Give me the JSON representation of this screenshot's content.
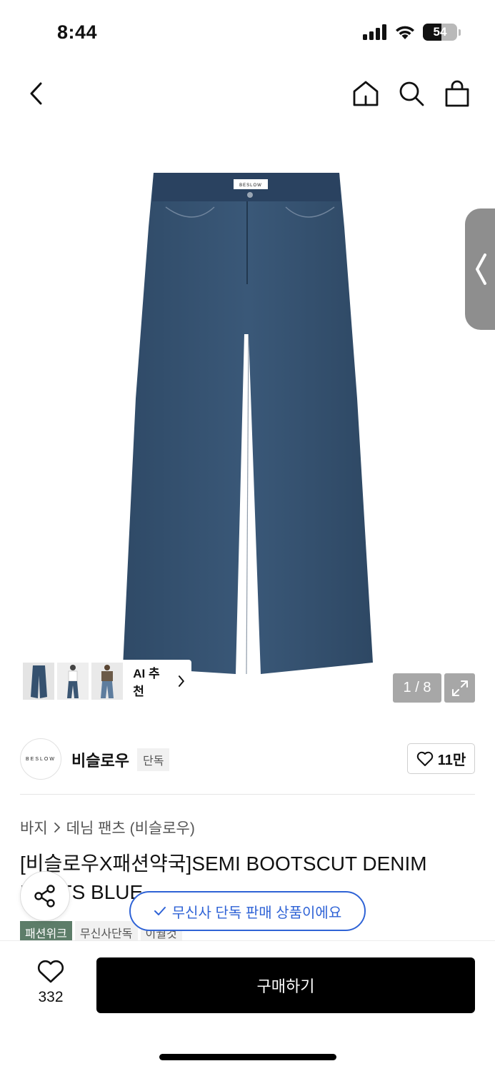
{
  "status": {
    "time": "8:44",
    "battery": "54",
    "battery_level": 0.54
  },
  "gallery": {
    "ai_label": "AI 추천",
    "counter": "1 / 8",
    "logo_text": "BESLOW"
  },
  "brand": {
    "logo_text": "BESLOW",
    "name": "비슬로우",
    "badge": "단독",
    "likes": "11만"
  },
  "breadcrumb": [
    "바지",
    "데님 팬츠 (비슬로우)"
  ],
  "product": {
    "title": "[비슬로우X패션약국]SEMI BOOTSCUT DENIM PANTS BLUE",
    "tags": [
      "패션위크",
      "무신사단독",
      "이월것"
    ]
  },
  "toast": {
    "text": "무신사 단독 판매 상품이에요"
  },
  "bottom": {
    "wish_count": "332",
    "buy_label": "구매하기"
  },
  "colors": {
    "accent_blue": "#2f63d6",
    "tag_green": "#5d7d69",
    "denim": "#34506f"
  }
}
